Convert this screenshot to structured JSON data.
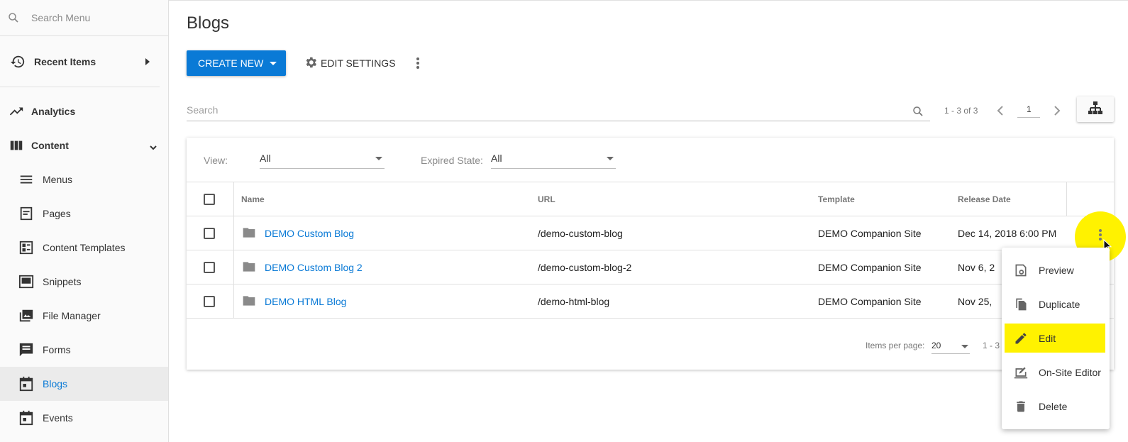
{
  "sidebar": {
    "search_placeholder": "Search Menu",
    "recent_items": "Recent Items",
    "analytics": "Analytics",
    "content": "Content",
    "items": [
      {
        "label": "Menus"
      },
      {
        "label": "Pages"
      },
      {
        "label": "Content Templates"
      },
      {
        "label": "Snippets"
      },
      {
        "label": "File Manager"
      },
      {
        "label": "Forms"
      },
      {
        "label": "Blogs"
      },
      {
        "label": "Events"
      }
    ]
  },
  "page": {
    "title": "Blogs",
    "create_new": "CREATE NEW",
    "edit_settings": "EDIT SETTINGS",
    "search_placeholder": "Search",
    "pager_range": "1 - 3 of 3",
    "page_number": "1"
  },
  "filters": {
    "view_label": "View:",
    "view_value": "All",
    "expired_label": "Expired State:",
    "expired_value": "All"
  },
  "table": {
    "headers": {
      "name": "Name",
      "url": "URL",
      "template": "Template",
      "release": "Release Date"
    },
    "rows": [
      {
        "name": "DEMO Custom Blog",
        "url": "/demo-custom-blog",
        "template": "DEMO Companion Site",
        "release": "Dec 14, 2018 6:00 PM"
      },
      {
        "name": "DEMO Custom Blog 2",
        "url": "/demo-custom-blog-2",
        "template": "DEMO Companion Site",
        "release": "Nov 6, 2"
      },
      {
        "name": "DEMO HTML Blog",
        "url": "/demo-html-blog",
        "template": "DEMO Companion Site",
        "release": "Nov 25,"
      }
    ],
    "items_per_page_label": "Items per page:",
    "items_per_page": "20",
    "footer_range": "1 - 3 o"
  },
  "row_menu": {
    "preview": "Preview",
    "duplicate": "Duplicate",
    "edit": "Edit",
    "on_site_editor": "On-Site Editor",
    "delete": "Delete"
  },
  "colors": {
    "accent": "#0a7ad6",
    "highlight": "#fff200"
  }
}
